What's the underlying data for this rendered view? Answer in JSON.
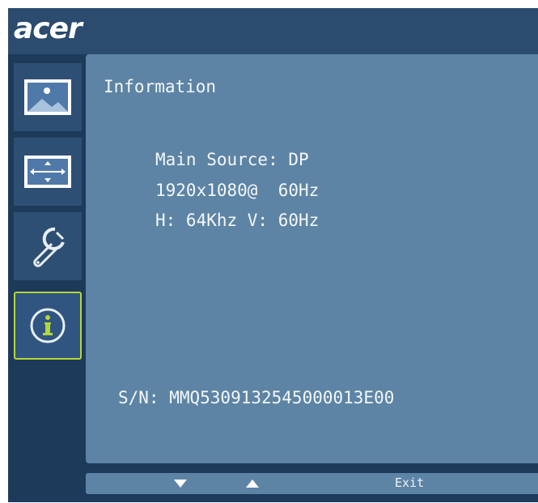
{
  "header": {
    "brand": "acer"
  },
  "sidebar": {
    "items": [
      {
        "name": "picture",
        "icon": "picture-icon",
        "selected": false
      },
      {
        "name": "display",
        "icon": "display-position-icon",
        "selected": false
      },
      {
        "name": "settings",
        "icon": "wrench-icon",
        "selected": false
      },
      {
        "name": "information",
        "icon": "info-icon",
        "selected": true
      }
    ]
  },
  "panel": {
    "title": "Information",
    "main_source": "Main Source: DP",
    "resolution": "1920x1080@  60Hz",
    "frequency": "H: 64Khz V: 60Hz",
    "serial": "S/N: MMQ5309132545000013E00"
  },
  "footer": {
    "down_icon": "down-arrow-icon",
    "up_icon": "up-arrow-icon",
    "exit_label": "Exit"
  },
  "colors": {
    "background": "#1d3a5a",
    "header": "#2b4b6f",
    "panel": "#5d84a4",
    "selected_border": "#b6d53a"
  }
}
